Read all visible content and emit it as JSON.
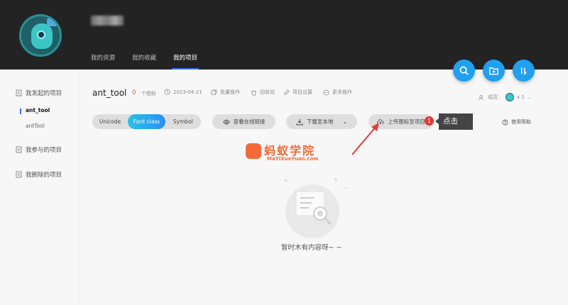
{
  "header": {
    "tabs": [
      {
        "label": "我的资源"
      },
      {
        "label": "我的收藏"
      },
      {
        "label": "我的项目",
        "active": true
      }
    ],
    "fab_icons": [
      "search-icon",
      "add-folder-icon",
      "sort-icon"
    ],
    "accent": "#1fa0f0"
  },
  "sidebar": {
    "sections": [
      {
        "label": "我发起的项目",
        "icon": "edit-icon"
      },
      {
        "label": "我参与的项目",
        "icon": "edit-icon"
      },
      {
        "label": "我删除的项目",
        "icon": "edit-icon"
      }
    ],
    "projects": [
      {
        "label": "ant_tool",
        "active": true
      },
      {
        "label": "antTool"
      }
    ]
  },
  "project": {
    "title": "ant_tool",
    "icon_count": "0",
    "icon_count_label": "个图标",
    "date": "2023-04-21",
    "actions": [
      "批量操作",
      "回收站",
      "项目设置",
      "更多操作"
    ],
    "members_label": "成员：",
    "members_count": "x 1"
  },
  "toolbar": {
    "segments": [
      "Unicode",
      "Font class",
      "Symbol"
    ],
    "active_segment": "Font class",
    "view_online": "查看在线链接",
    "download": "下载至本地",
    "upload": "上传图标至项目",
    "help": "使用帮助"
  },
  "annotation": {
    "badge": "1",
    "tooltip": "点击"
  },
  "watermark": {
    "title": "蚂蚁学院",
    "url": "MaYiXueYuan.com"
  },
  "empty": {
    "text": "暂时木有内容呀~ ~"
  }
}
